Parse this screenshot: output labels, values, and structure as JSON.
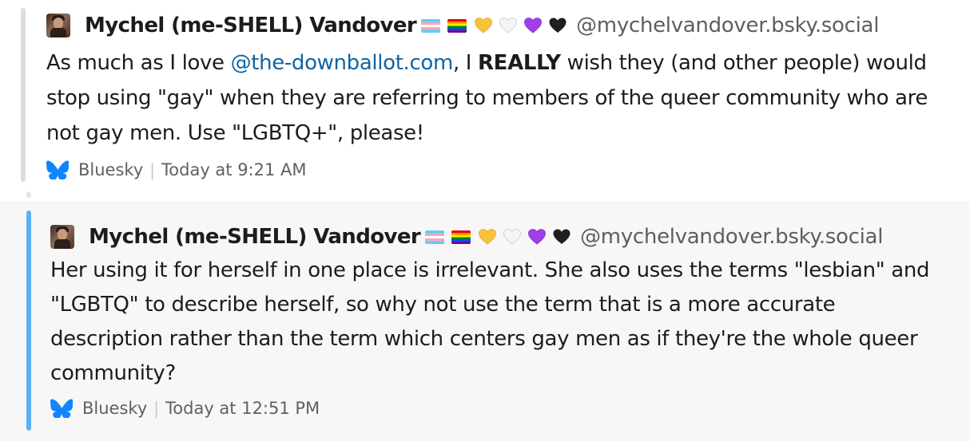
{
  "posts": [
    {
      "author": {
        "name": "Mychel (me-SHELL) Vandover",
        "handle": "@mychelvandover.bsky.social",
        "emoji_icons": [
          "transgender-flag-icon",
          "rainbow-flag-icon",
          "yellow-heart-icon",
          "white-heart-icon",
          "purple-heart-icon",
          "black-heart-icon"
        ]
      },
      "text_segments": {
        "l1_a": "As much as I love ",
        "l1_mention": "@the-downballot.com",
        "l1_b": ", I ",
        "l1_bold": "REALLY",
        "l1_c": " wish they (and other people) would",
        "l2": "stop using \"gay\" when they are referring to members of the queer community who are",
        "l3": "not gay men. Use \"LGBTQ+\", please!"
      },
      "source": "Bluesky",
      "timestamp": "Today at 9:21 AM",
      "accent_color": "#dddddd"
    },
    {
      "author": {
        "name": "Mychel (me-SHELL) Vandover",
        "handle": "@mychelvandover.bsky.social",
        "emoji_icons": [
          "transgender-flag-icon",
          "rainbow-flag-icon",
          "yellow-heart-icon",
          "white-heart-icon",
          "purple-heart-icon",
          "black-heart-icon"
        ]
      },
      "text_segments": {
        "l1": "Her using it for herself in one place is irrelevant. She also uses the terms \"lesbian\" and",
        "l2": "\"LGBTQ\" to describe herself, so why not use the term that is a more accurate",
        "l3": "description rather than the term which centers gay men as if they're the whole queer",
        "l4": "community?"
      },
      "source": "Bluesky",
      "timestamp": "Today at 12:51 PM",
      "accent_color": "#5eb0f3"
    }
  ],
  "colors": {
    "mention": "#1264a3",
    "bluesky_brand": "#1185fe",
    "muted_text": "#616061"
  }
}
